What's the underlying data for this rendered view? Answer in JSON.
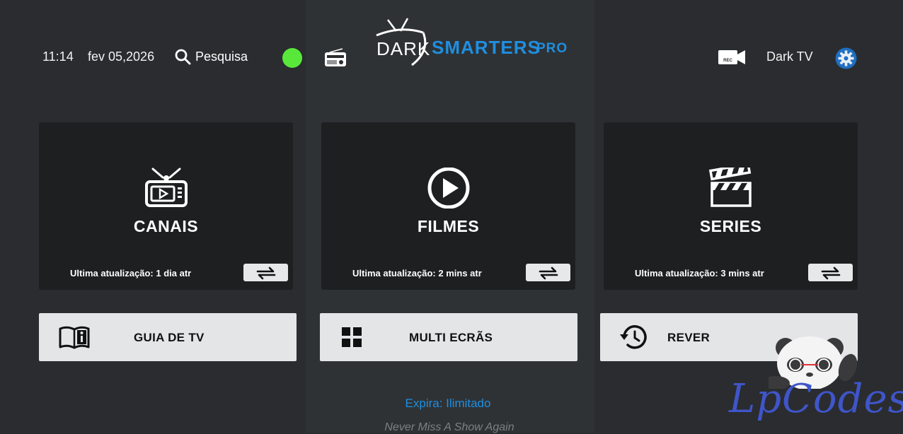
{
  "header": {
    "time": "11:14",
    "date": "fev 05,2026",
    "search_label": "Pesquisa",
    "status_color": "#59e83a",
    "logo": {
      "dark": "DARK",
      "smarters": "SMARTERS",
      "pro": "PRO"
    },
    "rec_label": "REC",
    "profile_name": "Dark TV"
  },
  "cards": [
    {
      "title": "CANAIS",
      "update": "Ultima atualização: 1 dia atr",
      "icon": "tv-icon"
    },
    {
      "title": "FILMES",
      "update": "Ultima atualização: 2 mins atr",
      "icon": "play-icon"
    },
    {
      "title": "SERIES",
      "update": "Ultima atualização: 3 mins atr",
      "icon": "clapperboard-icon"
    }
  ],
  "tiles": [
    {
      "label": "GUIA DE TV",
      "icon": "book-info-icon"
    },
    {
      "label": "MULTI ECRÃS",
      "icon": "grid-icon"
    },
    {
      "label": "REVER",
      "icon": "history-icon"
    }
  ],
  "footer": {
    "expira": "Expira: Ilimitado",
    "tagline": "Never Miss A Show Again"
  },
  "watermark": {
    "text": "LpCodes"
  },
  "colors": {
    "accent": "#1f8fe0",
    "background": "#2a2c2f",
    "card": "#1d1f21",
    "tile": "#e4e5e7"
  }
}
